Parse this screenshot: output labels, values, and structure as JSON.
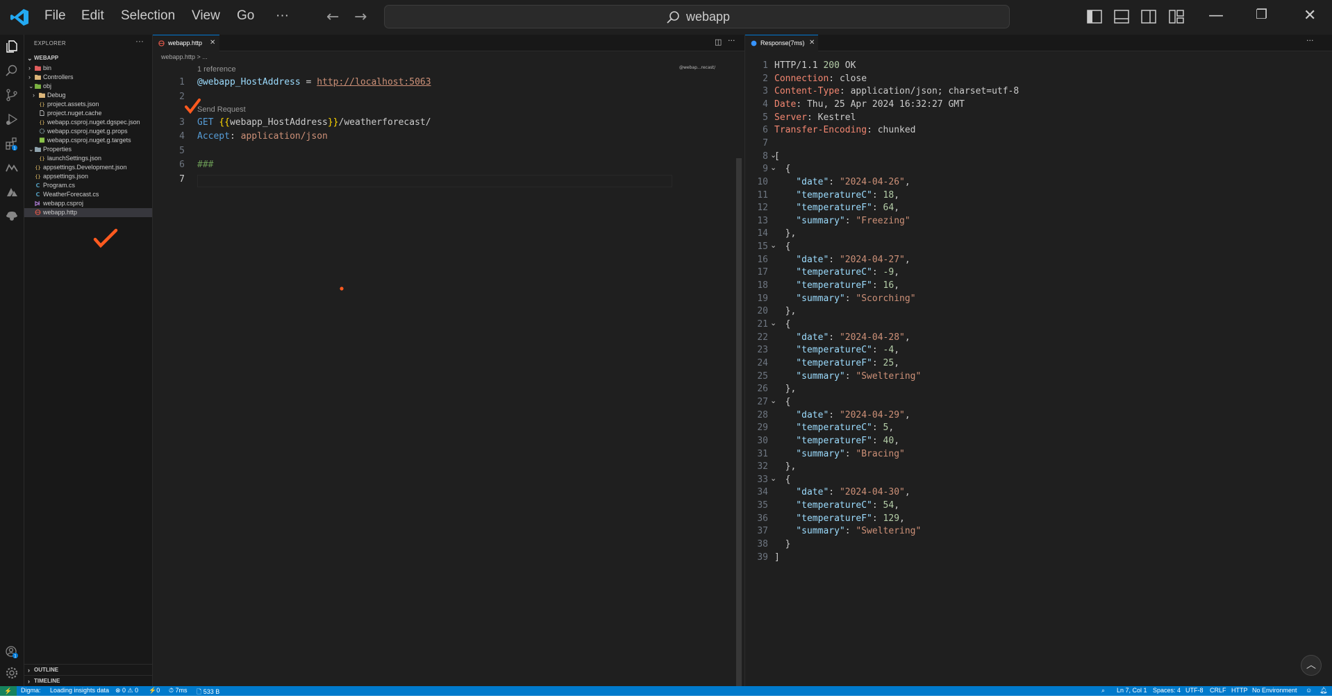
{
  "menu": [
    "File",
    "Edit",
    "Selection",
    "View",
    "Go",
    "···"
  ],
  "command_center": "webapp",
  "sidebar": {
    "title": "EXPLORER",
    "more": "···",
    "root": "WEBAPP",
    "items": [
      {
        "label": "bin",
        "depth": 1,
        "type": "folder-red",
        "chevron": "›"
      },
      {
        "label": "Controllers",
        "depth": 1,
        "type": "folder-yellow",
        "chevron": "›"
      },
      {
        "label": "obj",
        "depth": 1,
        "type": "folder-green",
        "chevron": "⌄"
      },
      {
        "label": "Debug",
        "depth": 2,
        "type": "folder-yellow",
        "chevron": "›"
      },
      {
        "label": "project.assets.json",
        "depth": 2,
        "type": "json"
      },
      {
        "label": "project.nuget.cache",
        "depth": 2,
        "type": "file"
      },
      {
        "label": "webapp.csproj.nuget.dgspec.json",
        "depth": 2,
        "type": "json"
      },
      {
        "label": "webapp.csproj.nuget.g.props",
        "depth": 2,
        "type": "gear"
      },
      {
        "label": "webapp.csproj.nuget.g.targets",
        "depth": 2,
        "type": "target"
      },
      {
        "label": "Properties",
        "depth": 1,
        "type": "folder-grey",
        "chevron": "⌄"
      },
      {
        "label": "launchSettings.json",
        "depth": 2,
        "type": "json"
      },
      {
        "label": "appsettings.Development.json",
        "depth": 1,
        "type": "json"
      },
      {
        "label": "appsettings.json",
        "depth": 1,
        "type": "json"
      },
      {
        "label": "Program.cs",
        "depth": 1,
        "type": "cs"
      },
      {
        "label": "WeatherForecast.cs",
        "depth": 1,
        "type": "cs"
      },
      {
        "label": "webapp.csproj",
        "depth": 1,
        "type": "csproj"
      },
      {
        "label": "webapp.http",
        "depth": 1,
        "type": "http",
        "selected": true
      }
    ],
    "sections": [
      "OUTLINE",
      "TIMELINE"
    ]
  },
  "editor1": {
    "tab": "webapp.http",
    "breadcrumb": "webapp.http > ...",
    "lens_reference": "1 reference",
    "lens_send": "Send Request",
    "minimap": "@webap...recast/",
    "line_numbers": [
      "1",
      "2",
      "3",
      "4",
      "5",
      "6",
      "7"
    ],
    "line1": {
      "var": "@webapp_HostAddress",
      "eq": " = ",
      "url": "http://localhost:5063"
    },
    "line3": {
      "method": "GET ",
      "open": "{{",
      "var": "webapp_HostAddress",
      "close": "}}",
      "path": "/weatherforecast/"
    },
    "line4": {
      "key": "Accept",
      "colon": ": ",
      "value": "application/json"
    },
    "line6": "###"
  },
  "editor2": {
    "tab": "Response(7ms)",
    "status": {
      "proto": "HTTP/1.1 ",
      "code": "200",
      "text": " OK"
    },
    "headers": [
      {
        "name": "Connection",
        "value": "close"
      },
      {
        "name": "Content-Type",
        "value": "application/json; charset=utf-8"
      },
      {
        "name": "Date",
        "value": "Thu, 25 Apr 2024 16:32:27 GMT"
      },
      {
        "name": "Server",
        "value": "Kestrel"
      },
      {
        "name": "Transfer-Encoding",
        "value": "chunked"
      }
    ],
    "forecasts": [
      {
        "date": "2024-04-26",
        "temperatureC": "18",
        "temperatureF": "64",
        "summary": "Freezing"
      },
      {
        "date": "2024-04-27",
        "temperatureC": "-9",
        "temperatureF": "16",
        "summary": "Scorching"
      },
      {
        "date": "2024-04-28",
        "temperatureC": "-4",
        "temperatureF": "25",
        "summary": "Sweltering"
      },
      {
        "date": "2024-04-29",
        "temperatureC": "5",
        "temperatureF": "40",
        "summary": "Bracing"
      },
      {
        "date": "2024-04-30",
        "temperatureC": "54",
        "temperatureF": "129",
        "summary": "Sweltering"
      }
    ]
  },
  "statusbar": {
    "remote": "⚡",
    "digma": "Digma:",
    "loading": "Loading insights data",
    "problems": "⊗ 0 ⚠ 0",
    "ports": "⚡0",
    "time": "⏱ 7ms",
    "size": "🗋 533 B",
    "position": "Ln 7, Col 1",
    "spaces": "Spaces: 4",
    "encoding": "UTF-8",
    "eol": "CRLF",
    "language": "HTTP",
    "environment": "No Environment"
  },
  "colors": {
    "accent": "#007acc",
    "orange_mark": "#ff5a1f"
  }
}
